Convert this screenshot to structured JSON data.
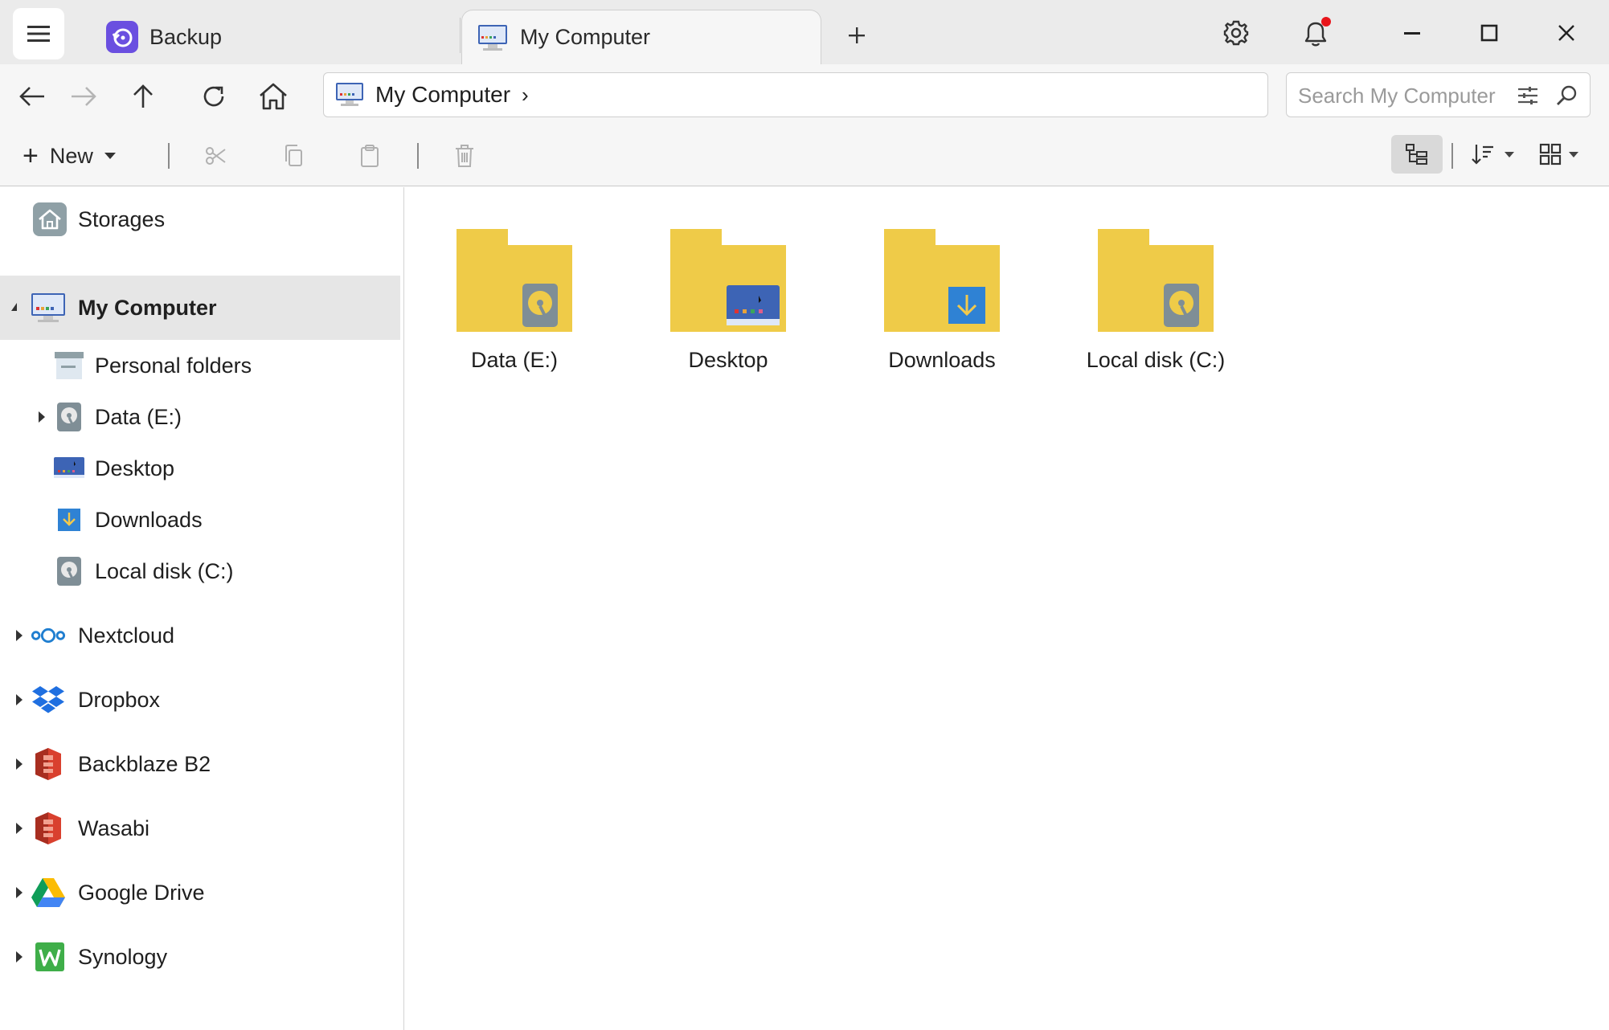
{
  "window": {
    "tabs": [
      {
        "label": "Backup",
        "active": false,
        "icon": "backup-icon"
      },
      {
        "label": "My Computer",
        "active": true,
        "icon": "monitor-icon"
      }
    ],
    "add_tab": "+",
    "controls": [
      "gear-icon",
      "bell-icon",
      "minimize-icon",
      "maximize-icon",
      "close-icon"
    ],
    "notification_dot_color": "#e8151b"
  },
  "nav": {
    "address_segment": "My Computer",
    "address_chevron": "›",
    "search_placeholder": "Search My Computer"
  },
  "toolbar": {
    "new_label": "New",
    "plus": "+"
  },
  "sidebar": {
    "storages_label": "Storages",
    "items": [
      {
        "label": "My Computer",
        "selected": true,
        "expanded": true,
        "icon": "monitor-icon"
      },
      {
        "label": "Personal folders",
        "icon": "personal-folders-icon"
      },
      {
        "label": "Data (E:)",
        "expandable": true,
        "icon": "drive-icon"
      },
      {
        "label": "Desktop",
        "icon": "desktop-icon"
      },
      {
        "label": "Downloads",
        "icon": "downloads-icon"
      },
      {
        "label": "Local disk (C:)",
        "icon": "drive-icon"
      },
      {
        "label": "Nextcloud",
        "expandable": true,
        "icon": "nextcloud-icon"
      },
      {
        "label": "Dropbox",
        "expandable": true,
        "icon": "dropbox-icon"
      },
      {
        "label": "Backblaze B2",
        "expandable": true,
        "icon": "backblaze-icon"
      },
      {
        "label": "Wasabi",
        "expandable": true,
        "icon": "wasabi-icon"
      },
      {
        "label": "Google Drive",
        "expandable": true,
        "icon": "google-drive-icon"
      },
      {
        "label": "Synology",
        "expandable": true,
        "icon": "synology-icon"
      }
    ]
  },
  "main": {
    "tiles": [
      {
        "label": "Data (E:)",
        "badge": "drive"
      },
      {
        "label": "Desktop",
        "badge": "desktop"
      },
      {
        "label": "Downloads",
        "badge": "download"
      },
      {
        "label": "Local disk (C:)",
        "badge": "drive"
      }
    ]
  },
  "colors": {
    "folder": "#efcb48",
    "accent_purple": "#6a4fe0",
    "selection": "#e6e6e6"
  }
}
